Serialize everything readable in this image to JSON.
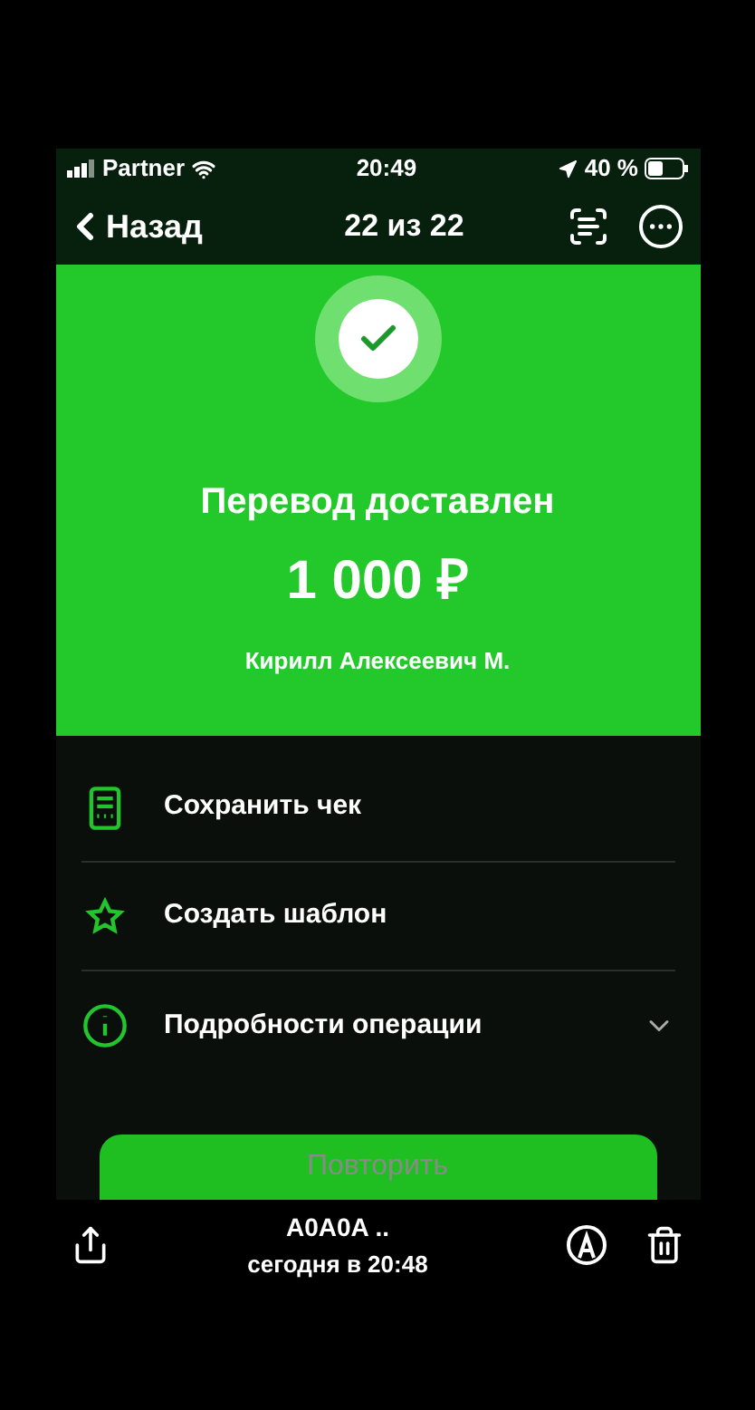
{
  "status_bar": {
    "carrier": "Partner",
    "time": "20:49",
    "battery": "40 %"
  },
  "nav": {
    "back": "Назад",
    "title": "22 из 22"
  },
  "result": {
    "title": "Перевод доставлен",
    "amount": "1 000 ₽",
    "recipient": "Кирилл Алексеевич М."
  },
  "actions": [
    {
      "kind": "receipt",
      "label": "Сохранить чек",
      "expandable": false
    },
    {
      "kind": "template",
      "label": "Создать шаблон",
      "expandable": false
    },
    {
      "kind": "details",
      "label": "Подробности операции",
      "expandable": true
    }
  ],
  "repeat_button": "Повторить",
  "viewer_toolbar": {
    "title": "A0A0A ..",
    "subtitle": "сегодня в 20:48"
  }
}
